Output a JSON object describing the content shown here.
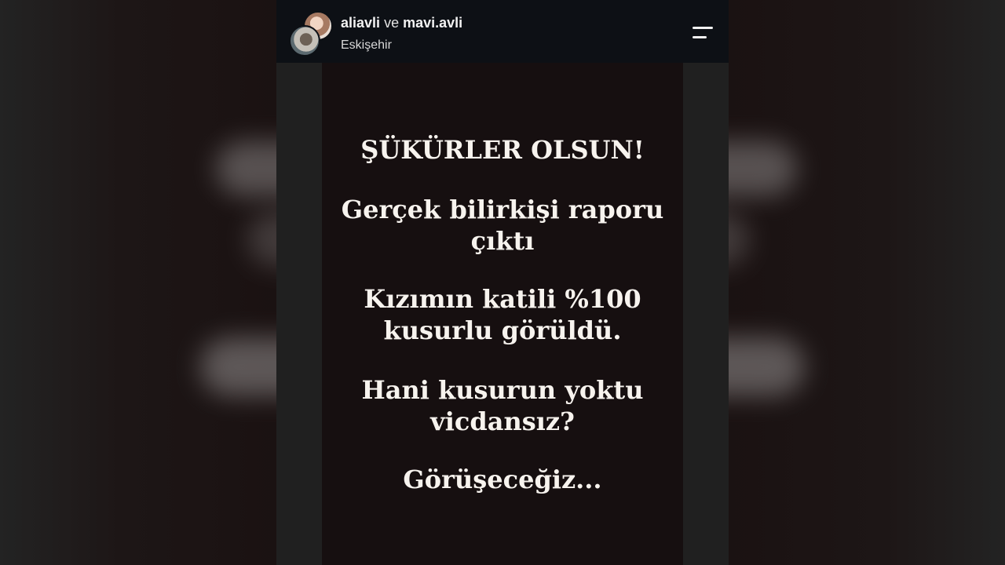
{
  "header": {
    "user1": "aliavli",
    "conjunction": "ve",
    "user2": "mavi.avli",
    "location": "Eskişehir",
    "icons": {
      "menu": "menu-lines-icon"
    }
  },
  "story": {
    "paragraphs": [
      {
        "line1": "ŞÜKÜRLER OLSUN!",
        "line2": ""
      },
      {
        "line1": "Gerçek bilirkişi raporu",
        "line2": "çıktı"
      },
      {
        "line1": "Kızımın katili %100",
        "line2": "kusurlu görüldü."
      },
      {
        "line1": "Hani kusurun yoktu",
        "line2": "vicdansız?"
      },
      {
        "line1": "Görüşeceğiz...",
        "line2": ""
      }
    ]
  },
  "colors": {
    "header_bg": "#0d1015",
    "story_bg": "#160f10",
    "text": "#f7f3ee"
  }
}
